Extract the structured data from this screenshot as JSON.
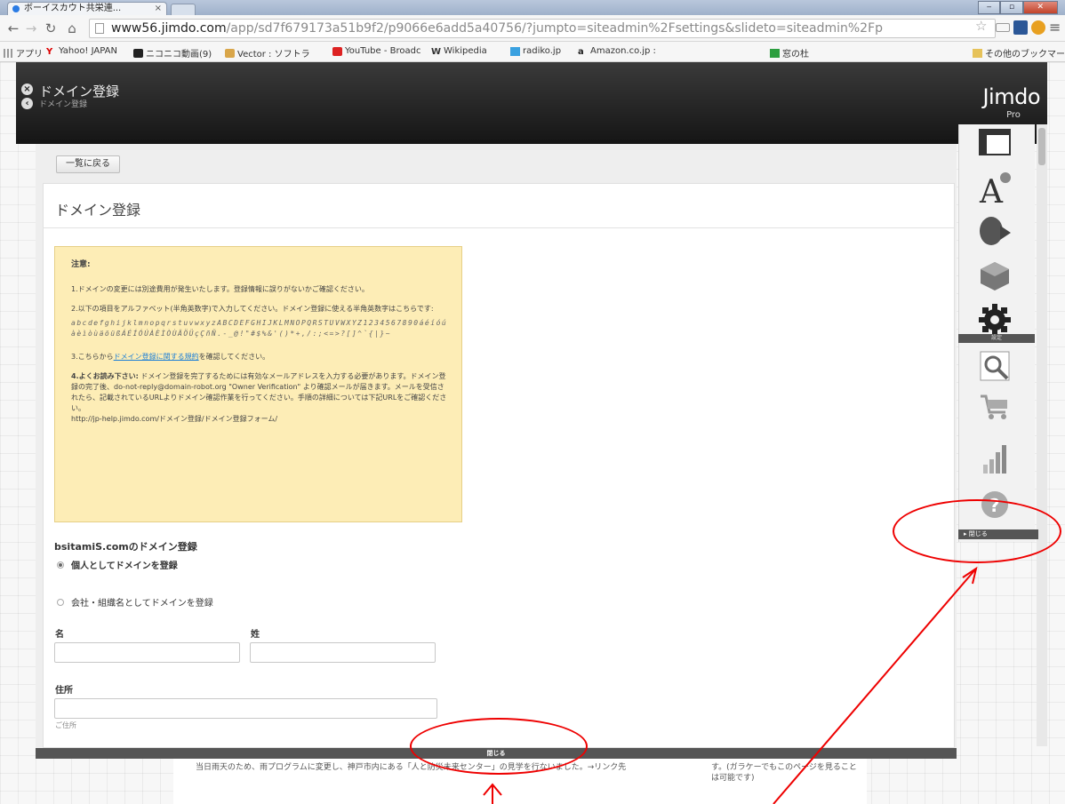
{
  "browser": {
    "tab_title": "ボーイスカウト共栄連...",
    "tab_close": "×",
    "url_host": "www56.jimdo.com",
    "url_path": "/app/sd7f679173a51b9f2/p9066e6add5a40756/?jumpto=siteadmin%2Fsettings&slideto=siteadmin%2Fp",
    "window_controls": [
      "‒",
      "▫",
      "✕"
    ],
    "bookmarks": [
      {
        "label": "アプリ",
        "icon": "apps-icon"
      },
      {
        "label": "Yahoo! JAPAN",
        "icon": "yahoo-icon"
      },
      {
        "label": "ニコニコ動画(9)",
        "icon": "niconico-icon"
      },
      {
        "label": "Vector : ソフトラ",
        "icon": "vector-icon"
      },
      {
        "label": "YouTube - Broadc",
        "icon": "youtube-icon"
      },
      {
        "label": "Wikipedia",
        "icon": "wikipedia-icon"
      },
      {
        "label": "radiko.jp",
        "icon": "radiko-icon"
      },
      {
        "label": "Amazon.co.jp :",
        "icon": "amazon-icon"
      },
      {
        "label": "窓の杜",
        "icon": "madonomori-icon"
      },
      {
        "label": "その他のブックマーク",
        "icon": "folder-icon"
      }
    ]
  },
  "header": {
    "title": "ドメイン登録",
    "subtitle": "ドメイン登録",
    "brand": "Jimdo",
    "plan": "Pro"
  },
  "panel": {
    "back_button": "一覧に戻る",
    "title": "ドメイン登録",
    "notice": {
      "heading": "注意:",
      "item1": "1.ドメインの変更には別途費用が発生いたします。登録情報に誤りがないかご確認ください。",
      "item2": "2.以下の項目をアルファベット(半角英数字)で入力してください。ドメイン登録に使える半角英数字はこちらです:",
      "charset": "abcdefghijklmnopqrstuvwxyzABCDEFGHIJKLMNOPQRSTUVWXYZ1234567890áéíóúàèìòùäöüßÁÉÍÓÚÀÈÌÒÙÄÖÜçÇñÑ.-_@!\"#$%&'()*+,/:;<=>?[]^`{|}~",
      "item3_prefix": "3.こちらから",
      "item3_link": "ドメイン登録に関する規約",
      "item3_suffix": "を確認してください。",
      "item4_bold": "4.よくお読み下さい:",
      "item4": "ドメイン登録を完了するためには有効なメールアドレスを入力する必要があります。ドメイン登録の完了後、do-not-reply@domain-robot.org \"Owner Verification\" より確認メールが届きます。メールを受信されたら、記載されているURLよりドメイン確認作業を行ってください。手順の詳細については下記URLをご確認ください。",
      "item4_url": "http://jp-help.jimdo.com/ドメイン登録/ドメイン登録フォーム/"
    },
    "registration_title": "bsitamiS.comのドメイン登録",
    "radio_individual": "個人としてドメインを登録",
    "radio_company": "会社・組織名としてドメインを登録",
    "first_name_label": "名",
    "last_name_label": "姓",
    "address_label": "住所",
    "address_help": "ご住所",
    "close_label": "閉じる"
  },
  "sidebar": {
    "icons": [
      "layout-icon",
      "style-icon",
      "media-icon",
      "addons-icon",
      "settings-icon",
      "seo-icon",
      "shop-icon",
      "stats-icon",
      "help-icon"
    ],
    "active_label": "設定",
    "close_label": "閉じる"
  },
  "background_page": {
    "text_left": "当日雨天のため、雨プログラムに変更し、神戸市内にある「人と防災未来センター」の見学を行ないました。→リンク先",
    "text_right": "す。(ガラケーでもこのページを見ることは可能です)"
  },
  "colors": {
    "annotation": "#e00000",
    "notice_bg": "#fdedb6",
    "header_bg": "#1e1e1e"
  }
}
